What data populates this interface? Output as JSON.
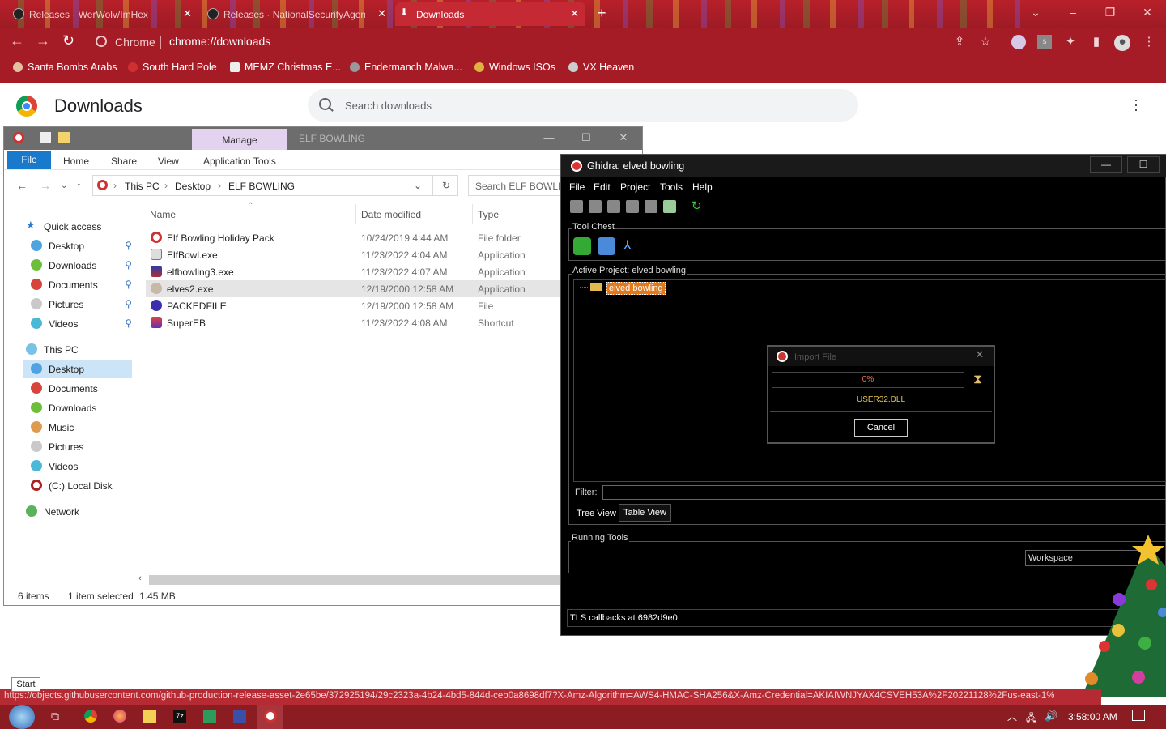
{
  "browser": {
    "tabs": [
      {
        "label": "Releases · WerWolv/ImHex",
        "active": false
      },
      {
        "label": "Releases · NationalSecurityAgen",
        "active": false
      },
      {
        "label": "Downloads",
        "active": true
      }
    ],
    "new_tab": "+",
    "omnibox": {
      "site": "Chrome",
      "url": "chrome://downloads"
    },
    "bookmarks": [
      "Santa Bombs Arabs",
      "South Hard Pole",
      "MEMZ Christmas E...",
      "Endermanch Malwa...",
      "Windows ISOs",
      "VX Heaven"
    ],
    "accent": "#a61c26"
  },
  "downloads_page": {
    "title": "Downloads",
    "search_placeholder": "Search downloads"
  },
  "explorer": {
    "title_tab": "Manage",
    "window_name": "ELF BOWLING",
    "ribbon": [
      "File",
      "Home",
      "Share",
      "View",
      "Application Tools"
    ],
    "path": [
      "This PC",
      "Desktop",
      "ELF BOWLING"
    ],
    "search_placeholder": "Search ELF BOWLING",
    "nav": [
      {
        "label": "Quick access",
        "level": 0
      },
      {
        "label": "Desktop",
        "level": 1,
        "pinned": true
      },
      {
        "label": "Downloads",
        "level": 1,
        "pinned": true
      },
      {
        "label": "Documents",
        "level": 1,
        "pinned": true
      },
      {
        "label": "Pictures",
        "level": 1,
        "pinned": true
      },
      {
        "label": "Videos",
        "level": 1,
        "pinned": true
      },
      {
        "label": "This PC",
        "level": 0
      },
      {
        "label": "Desktop",
        "level": 1,
        "selected": true
      },
      {
        "label": "Documents",
        "level": 1
      },
      {
        "label": "Downloads",
        "level": 1
      },
      {
        "label": "Music",
        "level": 1
      },
      {
        "label": "Pictures",
        "level": 1
      },
      {
        "label": "Videos",
        "level": 1
      },
      {
        "label": "(C:) Local Disk",
        "level": 1
      },
      {
        "label": "Network",
        "level": 0
      }
    ],
    "columns": [
      "Name",
      "Date modified",
      "Type"
    ],
    "files": [
      {
        "name": "Elf Bowling Holiday Pack",
        "date": "10/24/2019 4:44 AM",
        "type": "File folder"
      },
      {
        "name": "ElfBowl.exe",
        "date": "11/23/2022 4:04 AM",
        "type": "Application"
      },
      {
        "name": "elfbowling3.exe",
        "date": "11/23/2022 4:07 AM",
        "type": "Application"
      },
      {
        "name": "elves2.exe",
        "date": "12/19/2000 12:58 AM",
        "type": "Application",
        "selected": true
      },
      {
        "name": "PACKEDFILE",
        "date": "12/19/2000 12:58 AM",
        "type": "File"
      },
      {
        "name": "SuperEB",
        "date": "11/23/2022 4:08 AM",
        "type": "Shortcut"
      }
    ],
    "status": {
      "items": "6 items",
      "selected": "1 item selected",
      "size": "1.45 MB"
    }
  },
  "ghidra": {
    "title": "Ghidra: elved bowling",
    "menu": [
      "File",
      "Edit",
      "Project",
      "Tools",
      "Help"
    ],
    "tool_chest_label": "Tool Chest",
    "active_project_label": "Active Project: elved bowling",
    "project_node": "elved bowling",
    "filter_label": "Filter:",
    "tabs": [
      "Tree View",
      "Table View"
    ],
    "running_tools_label": "Running Tools",
    "workspace": "Workspace",
    "status": "TLS callbacks at 6982d9e0",
    "import_dialog": {
      "title": "Import File",
      "progress": "0%",
      "file": "USER32.DLL",
      "cancel": "Cancel"
    }
  },
  "status_url": "https://objects.githubusercontent.com/github-production-release-asset-2e65be/372925194/29c2323a-4b24-4bd5-844d-ceb0a8698df7?X-Amz-Algorithm=AWS4-HMAC-SHA256&X-Amz-Credential=AKIAIWNJYAX4CSVEH53A%2F20221128%2Fus-east-1%",
  "taskbar": {
    "start_tooltip": "Start",
    "clock": "3:58:00 AM"
  }
}
